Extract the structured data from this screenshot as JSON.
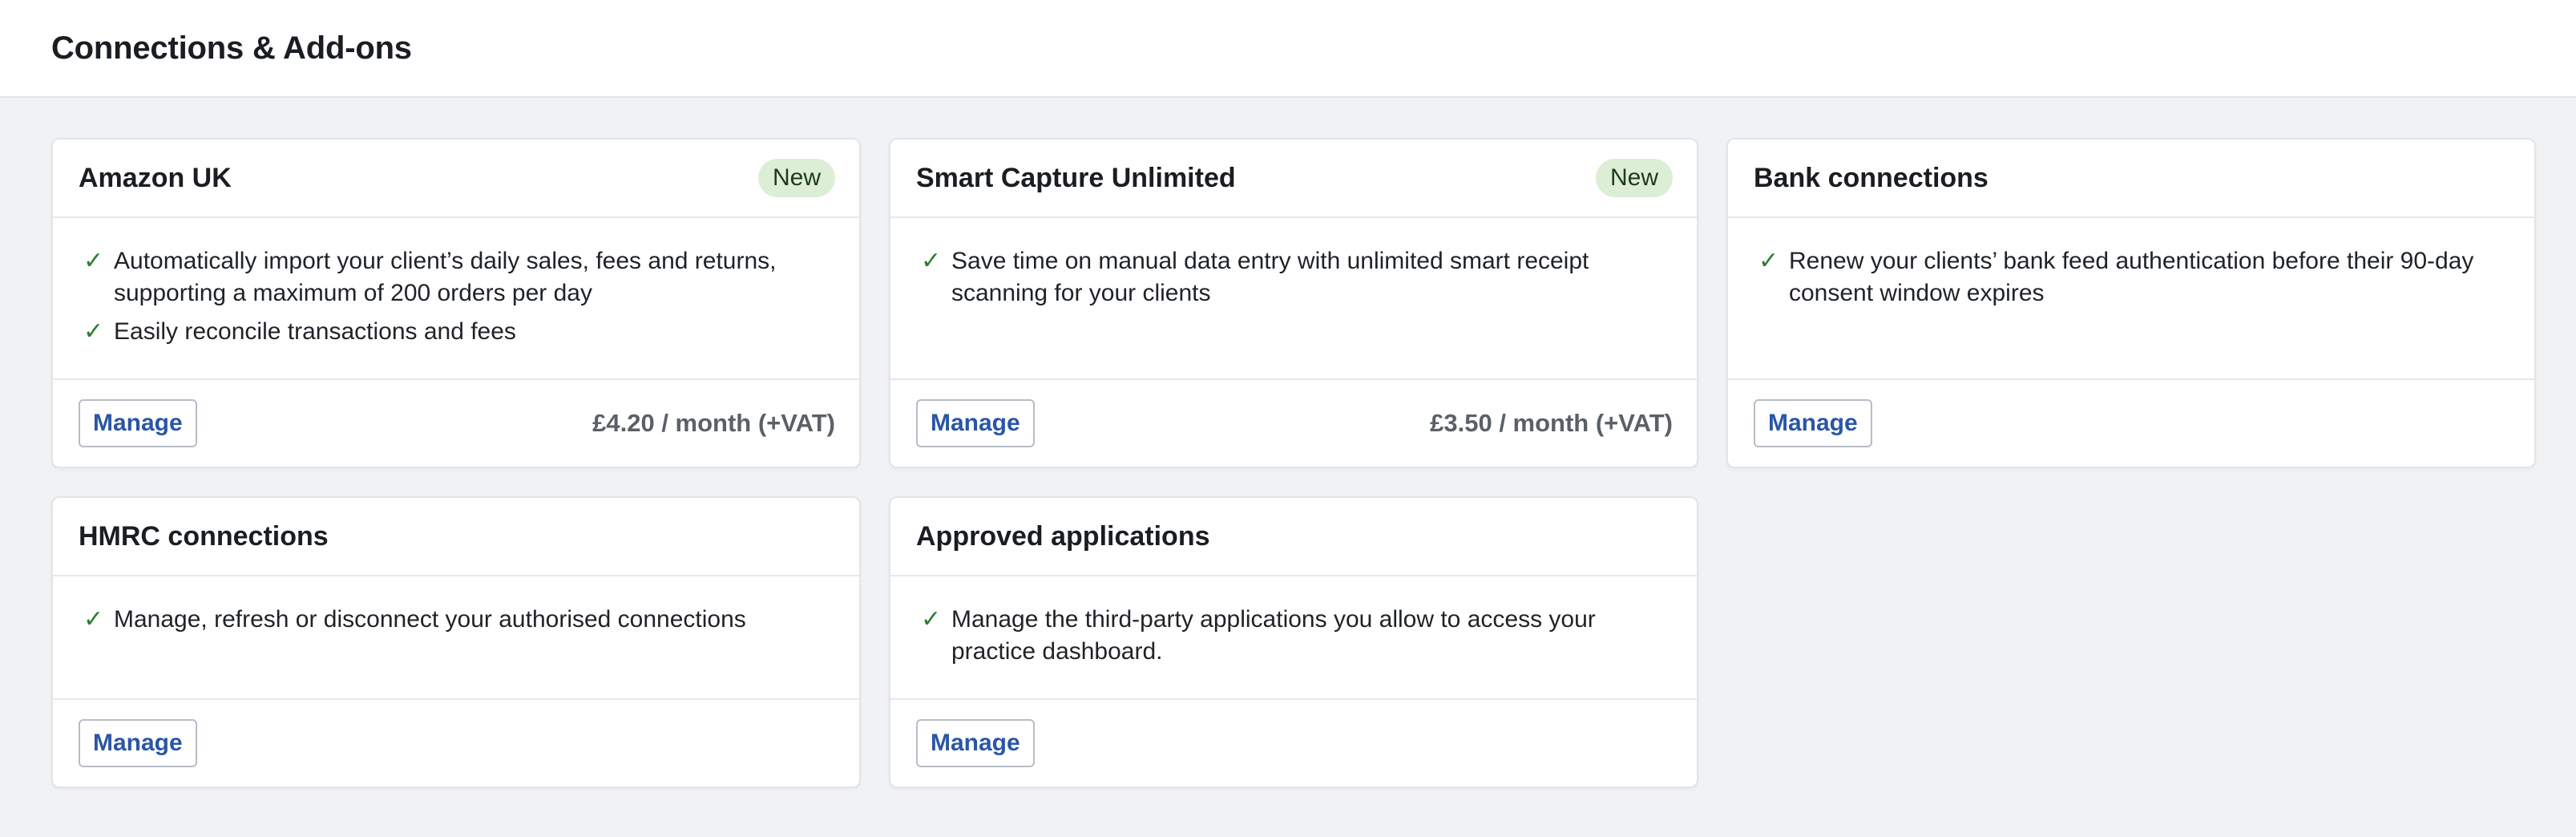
{
  "page": {
    "title": "Connections & Add-ons"
  },
  "icons": {
    "check": "check-icon"
  },
  "colors": {
    "accent_link": "#2a56a6",
    "badge_bg": "#dcefd6",
    "check_green": "#2e7d32",
    "page_bg": "#f1f2f4"
  },
  "cards": [
    {
      "title": "Amazon UK",
      "badge": "New",
      "features": [
        "Automatically import your client’s daily sales, fees and returns, supporting a maximum of 200 orders per day",
        "Easily reconcile transactions and fees"
      ],
      "button": "Manage",
      "price": "£4.20 / month (+VAT)"
    },
    {
      "title": "Smart Capture Unlimited",
      "badge": "New",
      "features": [
        "Save time on manual data entry with unlimited smart receipt scanning for your clients"
      ],
      "button": "Manage",
      "price": "£3.50 / month (+VAT)"
    },
    {
      "title": "Bank connections",
      "features": [
        "Renew your clients’ bank feed authentication before their 90-day consent window expires"
      ],
      "button": "Manage"
    },
    {
      "title": "HMRC connections",
      "features": [
        "Manage, refresh or disconnect your authorised connections"
      ],
      "button": "Manage"
    },
    {
      "title": "Approved applications",
      "features": [
        "Manage the third-party applications you allow to access your practice dashboard."
      ],
      "button": "Manage"
    }
  ]
}
